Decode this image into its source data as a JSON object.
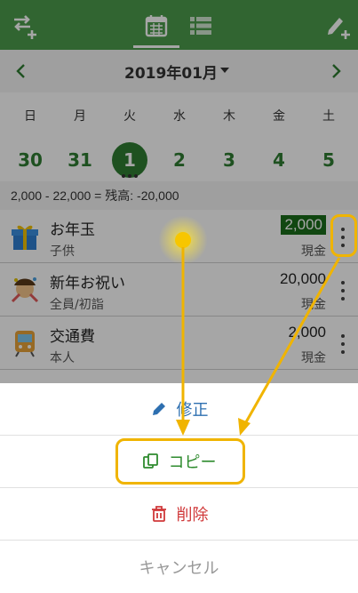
{
  "appbar": {
    "icons": {
      "left": "swap-arrows-add-icon",
      "tab_calendar": "calendar-icon",
      "tab_list": "list-icon",
      "right": "pencil-add-icon"
    },
    "color": "#4c9c4c"
  },
  "calendar": {
    "month_label": "2019年01月",
    "weekdays": [
      "日",
      "月",
      "火",
      "水",
      "木",
      "金",
      "土"
    ],
    "days": [
      "30",
      "31",
      "1",
      "2",
      "3",
      "4",
      "5"
    ],
    "selected_day": "1"
  },
  "summary": {
    "text": "2,000 - 22,000 = 残高: -20,000"
  },
  "entries": [
    {
      "title": "お年玉",
      "sub": "子供",
      "amount": "2,000",
      "payment": "現金",
      "icon": "gift-icon"
    },
    {
      "title": "新年お祝い",
      "sub": "全員/初詣",
      "amount": "20,000",
      "payment": "現金",
      "icon": "celebration-icon"
    },
    {
      "title": "交通費",
      "sub": "本人",
      "amount": "2,000",
      "payment": "現金",
      "icon": "train-icon"
    }
  ],
  "sheet": {
    "edit_label": "修正",
    "copy_label": "コピー",
    "delete_label": "削除",
    "cancel_label": "キャンセル"
  },
  "colors": {
    "accent": "#2e7d32",
    "highlight": "#f0b400",
    "edit": "#2d6fb0",
    "delete": "#d0393a"
  }
}
